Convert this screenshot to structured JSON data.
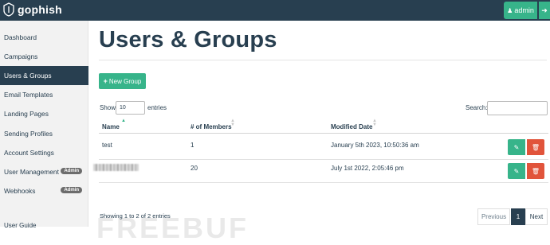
{
  "app": {
    "brand": "gophish",
    "user_label": "admin"
  },
  "sidebar": {
    "items": [
      {
        "label": "Dashboard"
      },
      {
        "label": "Campaigns"
      },
      {
        "label": "Users & Groups",
        "active": true
      },
      {
        "label": "Email Templates"
      },
      {
        "label": "Landing Pages"
      },
      {
        "label": "Sending Profiles"
      },
      {
        "label": "Account Settings"
      },
      {
        "label": "User Management",
        "badge": "Admin"
      },
      {
        "label": "Webhooks",
        "badge": "Admin"
      }
    ],
    "partial_item": "User Guide"
  },
  "main": {
    "title": "Users & Groups",
    "new_group_label": "New Group",
    "length": {
      "show_label": "Show",
      "value": "10",
      "entries_label": "entries"
    },
    "search": {
      "label": "Search:",
      "value": ""
    },
    "table": {
      "columns": [
        "Name",
        "# of Members",
        "Modified Date"
      ],
      "rows": [
        {
          "name": "test",
          "members": "1",
          "modified": "January 5th 2023, 10:50:36 am"
        },
        {
          "name": "",
          "members": "20",
          "modified": "July 1st 2022, 2:05:46 pm"
        }
      ]
    },
    "info": "Showing 1 to 2 of 2 entries",
    "pagination": {
      "previous": "Previous",
      "current": "1",
      "next": "Next"
    }
  },
  "watermark": "FREEBUF",
  "colors": {
    "navbar": "#283f50",
    "accent": "#37b48a",
    "danger": "#e1543b",
    "sidebar_bg": "#f2f2f2"
  },
  "icons": {
    "brand": "shield-logo-icon",
    "user": "user-icon",
    "logout": "sign-out-icon",
    "add": "plus-icon",
    "edit": "pencil-icon",
    "delete": "trash-icon"
  }
}
